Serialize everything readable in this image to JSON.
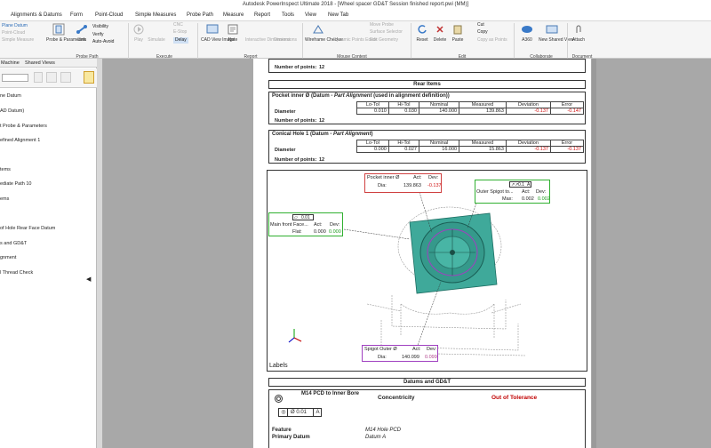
{
  "window": {
    "title": "Autodesk PowerInspect Ultimate 2018 - [Wheel spacer GD&T Session finished report.pwi (MM)]"
  },
  "menu": [
    {
      "label": "Alignments & Datums",
      "active": false
    },
    {
      "label": "Form",
      "active": false
    },
    {
      "label": "Point-Cloud",
      "active": false
    },
    {
      "label": "Simple Measures",
      "active": false
    },
    {
      "label": "Probe Path",
      "active": false
    },
    {
      "label": "Measure",
      "active": false
    },
    {
      "label": "Report",
      "active": false
    },
    {
      "label": "Tools",
      "active": false
    },
    {
      "label": "View",
      "active": false
    },
    {
      "label": "New Tab",
      "active": false
    }
  ],
  "ribbon": {
    "left_items": [
      "Plane Datum",
      "Point-Cloud",
      "Simple Measure"
    ],
    "probe_params": "Probe & Parameters",
    "link": "Link",
    "visibility": "Visibility",
    "verify": "Verify",
    "auto_avoid": "Auto-Avoid",
    "play": "Play",
    "simulate": "Simulate",
    "cnc": "CNC",
    "estop": "E-Stop",
    "delay": "Delay",
    "cad_view_image": "CAD View Image",
    "note": "Note",
    "interactive_dimensions": "Interactive Dimensions",
    "dimensions": "Dimensions",
    "wireframe_checker": "Wireframe Checker",
    "dynamic_points_editor": "Dynamic Points Editor",
    "move_probe": "Move Probe",
    "surface_selector": "Surface Selector",
    "edit_geometry": "Edit Geometry",
    "reset": "Reset",
    "delete": "Delete",
    "paste": "Paste",
    "cut": "Cut",
    "copy": "Copy",
    "copy_as_points": "Copy as Points",
    "a360": "A360",
    "new_shared_view": "New Shared View",
    "attach": "Attach",
    "groups": [
      "Probe Path",
      "Execute",
      "Report",
      "Mouse Context",
      "Edit",
      "Collaborate",
      "Document"
    ]
  },
  "sidebar": {
    "tabs": [
      "Machine",
      "Shared Views"
    ],
    "items": [
      "ne Datum",
      "AD Datum)",
      "t Probe & Parameters",
      "efined Alignment 1",
      "tems",
      "ediate Path 10",
      "ems",
      "of Hole Rear Face Datum",
      "s and GD&T",
      "gnment",
      "l Thread Check"
    ]
  },
  "report": {
    "points_label": "Number of points:",
    "top_points": "12",
    "rear_items_header": "Rear Items",
    "pocket": {
      "title": "Pocket inner Ø (Datum - ",
      "title_italic": "Part Alignment",
      "title_tail": " (used in alignment definition))",
      "row_label": "Diameter",
      "cols": [
        "Lo-Tol",
        "Hi-Tol",
        "Nominal",
        "Measured",
        "Deviation",
        "Error"
      ],
      "vals": [
        "0.010",
        "0.030",
        "140.000",
        "139.863",
        "-0.137",
        "-0.147"
      ],
      "points": "12"
    },
    "conical": {
      "title": "Conical Hole 1 (Datum - ",
      "title_italic": "Part Alignment",
      "title_tail": ")",
      "row_label": "Diameter",
      "cols": [
        "Lo-Tol",
        "Hi-Tol",
        "Nominal",
        "Measured",
        "Deviation",
        "Error"
      ],
      "vals": [
        "0.000",
        "0.027",
        "16.000",
        "15.863",
        "-0.137",
        "-0.137"
      ],
      "points": "12"
    },
    "labels_caption": "Labels",
    "label_pocket": {
      "name": "Pocket inner Ø",
      "act": "Act:",
      "dev": "Dev:",
      "row": "Dia:",
      "actv": "139.863",
      "devv": "-0.137"
    },
    "label_spigot": {
      "tol": "0.1",
      "datum": "A",
      "name": "Outer Spigot to...",
      "act": "Act:",
      "dev": "Dev:",
      "row": "Max:",
      "actv": "0.002",
      "devv": "0.002"
    },
    "label_face": {
      "tol": "0.01",
      "name": "Main front Face...",
      "act": "Act:",
      "dev": "Dev:",
      "row": "Flat:",
      "actv": "0.000",
      "devv": "0.000"
    },
    "label_outer": {
      "name": "Spigot Outer Ø",
      "act": "Act:",
      "dev": "Dev:",
      "row": "Dia:",
      "actv": "140.099",
      "devv": "0.099"
    },
    "datums_header": "Datums and GD&T",
    "gdt": {
      "name": "M14 PCD to Inner Bore",
      "type": "Concentricity",
      "status": "Out of Tolerance",
      "frame_tol": "Ø 0.01",
      "frame_datum": "A",
      "feature_label": "Feature",
      "feature_val": "M14 Hole PCD",
      "primary_label": "Primary Datum",
      "primary_val": "Datum A"
    }
  }
}
